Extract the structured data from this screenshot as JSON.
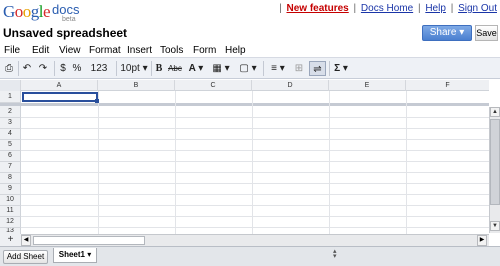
{
  "header": {
    "logo_letters": [
      "G",
      "o",
      "o",
      "g",
      "l",
      "e"
    ],
    "product": "docs",
    "beta": "beta",
    "links": [
      "New features",
      "Docs Home",
      "Help",
      "Sign Out"
    ],
    "doc_title": "Unsaved spreadsheet",
    "share_label": "Share ▾",
    "save_label": "Save"
  },
  "menubar": {
    "items": [
      "File",
      "Edit",
      "View",
      "Format",
      "Insert",
      "Tools",
      "Form",
      "Help"
    ]
  },
  "toolbar": {
    "print": "⎙",
    "undo": "↶",
    "redo": "↷",
    "currency": "$",
    "percent": "%",
    "number_format": "123 ▾",
    "font_size": "10pt ▾",
    "bold": "B",
    "strikethrough": "Abc",
    "text_color": "A ▾",
    "bg_color": "▦ ▾",
    "borders": "▢ ▾",
    "align": "≡ ▾",
    "merge": "⊞",
    "wrap": "⇌",
    "formula": "Σ ▾"
  },
  "grid": {
    "columns": [
      "A",
      "B",
      "C",
      "D",
      "E",
      "F"
    ],
    "frozen_row": "1",
    "rows": [
      "2",
      "3",
      "4",
      "5",
      "6",
      "7",
      "8",
      "9",
      "10",
      "11",
      "12",
      "13"
    ]
  },
  "bottom": {
    "add_sheet": "Add Sheet",
    "sheet_tab": "Sheet1 ▾",
    "plus": "+"
  },
  "colors": {
    "share_button": "#4a7fd0",
    "new_features": "#c50000",
    "link": "#1a35a8",
    "active_cell": "#2a4f9c"
  }
}
